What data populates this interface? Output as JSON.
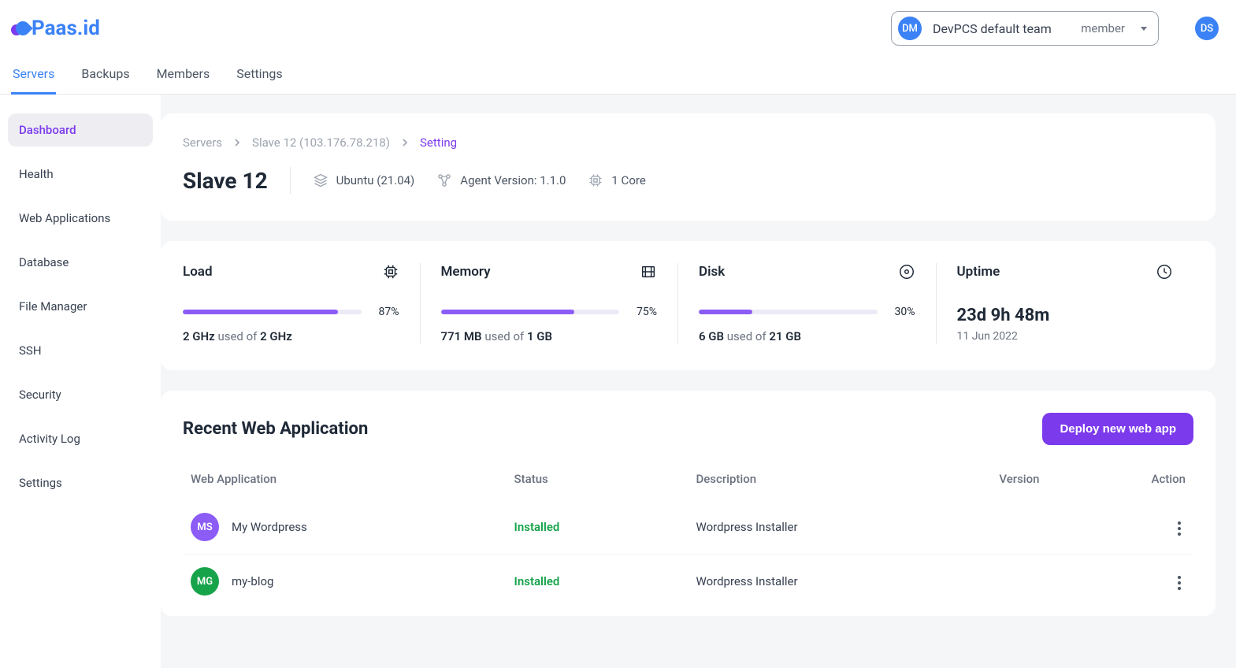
{
  "brand": "Paas.id",
  "team": {
    "initials": "DM",
    "name": "DevPCS default team",
    "role": "member"
  },
  "user": {
    "initials": "DS"
  },
  "tabs": [
    {
      "label": "Servers",
      "active": true
    },
    {
      "label": "Backups"
    },
    {
      "label": "Members"
    },
    {
      "label": "Settings"
    }
  ],
  "sidebar": [
    {
      "label": "Dashboard",
      "active": true
    },
    {
      "label": "Health"
    },
    {
      "label": "Web Applications"
    },
    {
      "label": "Database"
    },
    {
      "label": "File Manager"
    },
    {
      "label": "SSH"
    },
    {
      "label": "Security"
    },
    {
      "label": "Activity Log"
    },
    {
      "label": "Settings"
    }
  ],
  "breadcrumb": {
    "items": [
      "Servers",
      "Slave 12 (103.176.78.218)",
      "Setting"
    ]
  },
  "server": {
    "name": "Slave 12",
    "os": "Ubuntu (21.04)",
    "agent": "Agent Version: 1.1.0",
    "cores": "1 Core"
  },
  "stats": {
    "load": {
      "title": "Load",
      "pct": 87,
      "used": "2 GHz",
      "total": "2 GHz",
      "pct_label": "87%"
    },
    "memory": {
      "title": "Memory",
      "pct": 75,
      "used": "771 MB",
      "total": "1 GB",
      "pct_label": "75%"
    },
    "disk": {
      "title": "Disk",
      "pct": 30,
      "used": "6 GB",
      "total": "21 GB",
      "pct_label": "30%"
    },
    "uptime": {
      "title": "Uptime",
      "value": "23d 9h 48m",
      "date": "11 Jun 2022"
    },
    "used_of_label": " used of "
  },
  "recent": {
    "title": "Recent Web Application",
    "deploy_label": "Deploy new web app",
    "columns": {
      "app": "Web Application",
      "status": "Status",
      "desc": "Description",
      "version": "Version",
      "action": "Action"
    },
    "rows": [
      {
        "initials": "MS",
        "color": "#8b5cf6",
        "name": "My Wordpress",
        "status": "Installed",
        "desc": "Wordpress Installer",
        "version": ""
      },
      {
        "initials": "MG",
        "color": "#16a34a",
        "name": "my-blog",
        "status": "Installed",
        "desc": "Wordpress Installer",
        "version": ""
      }
    ]
  }
}
